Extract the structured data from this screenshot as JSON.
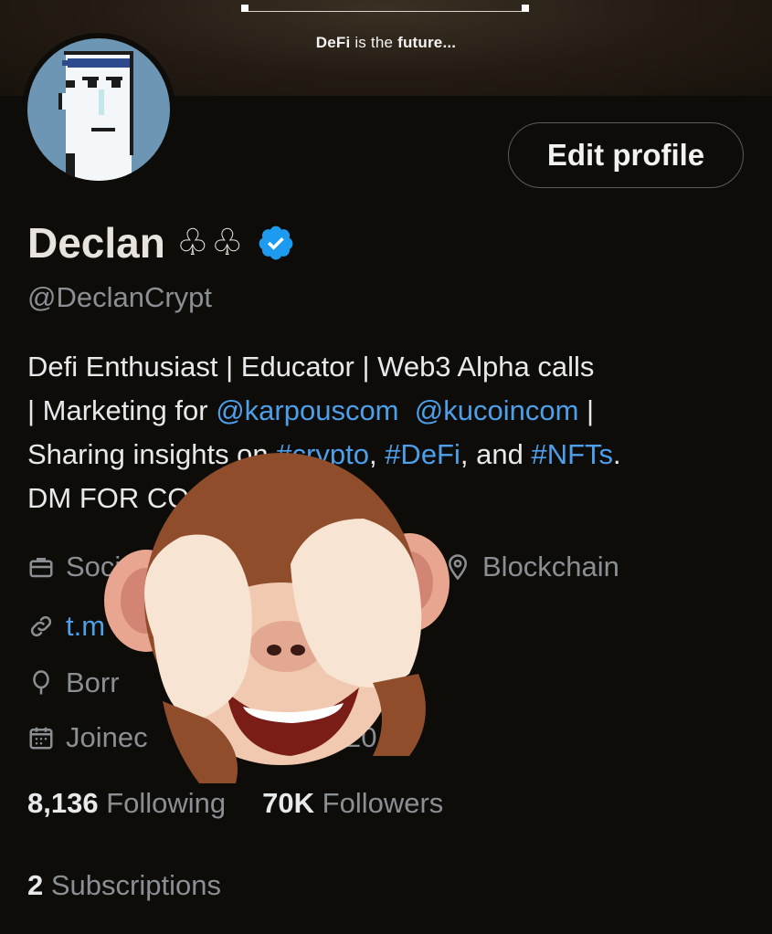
{
  "banner": {
    "caption_prefix": "DeFi",
    "caption_middle": " is the ",
    "caption_suffix": "future..."
  },
  "profile": {
    "edit_button_label": "Edit profile",
    "name": "Declan",
    "name_symbols": "♧♧",
    "handle": "@DeclanCrypt",
    "bio": {
      "line1": "Defi Enthusiast | Educator | Web3 Alpha calls",
      "line2_prefix": "| Marketing for ",
      "mention1": "@karpouscom",
      "mention2": "@kucoincom",
      "line2_suffix": " |",
      "line3_prefix": "Sharing insights on ",
      "hashtag1": "#crypto",
      "hashtag2": "#DeFi",
      "line3_and": ", and ",
      "hashtag3": "#NFTs",
      "line3_suffix": ".",
      "line4": "DM FOR CO"
    }
  },
  "meta": {
    "category": "Soci",
    "location": "Blockchain",
    "website": "t.m",
    "birth": "Borr",
    "joined": "Joinec",
    "joined_tail": "20"
  },
  "stats": {
    "following_count": "8,136",
    "following_label": "Following",
    "followers_count": "70K",
    "followers_label": "Followers",
    "subscriptions_count": "2",
    "subscriptions_label": "Subscriptions"
  },
  "colors": {
    "background": "#0e0c09",
    "link": "#4d9fea",
    "verified": "#1d9bf0",
    "muted": "#8b8f93"
  },
  "icons": {
    "verified": "verified-badge-icon",
    "category": "briefcase-icon",
    "location": "location-pin-icon",
    "website": "link-icon",
    "birth": "balloon-icon",
    "joined": "calendar-icon"
  }
}
